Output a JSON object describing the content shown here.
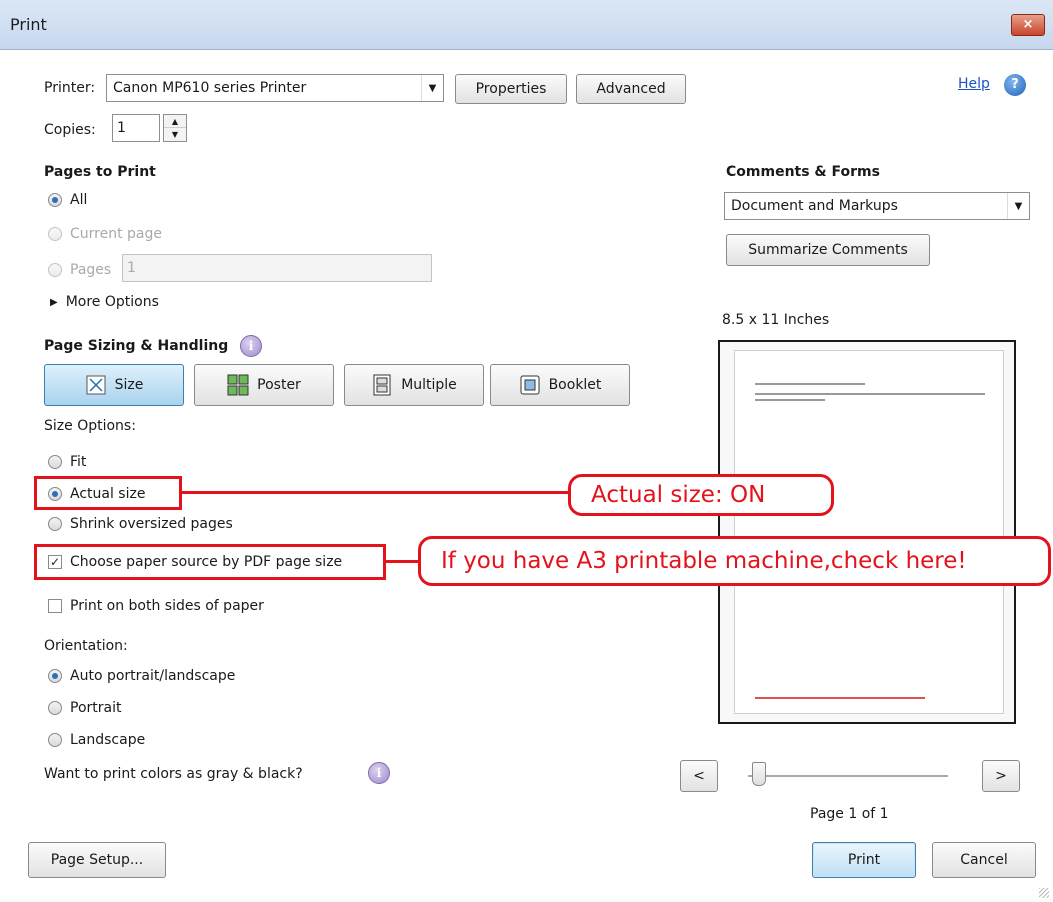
{
  "window": {
    "title": "Print",
    "close_glyph": "×"
  },
  "printer": {
    "label": "Printer:",
    "selected": "Canon MP610 series Printer",
    "properties_label": "Properties",
    "advanced_label": "Advanced",
    "help_label": "Help"
  },
  "copies": {
    "label": "Copies:",
    "value": "1"
  },
  "pages_to_print": {
    "heading": "Pages to Print",
    "all": "All",
    "current_page": "Current page",
    "pages": "Pages",
    "pages_value": "1",
    "more_options": "More Options"
  },
  "page_sizing": {
    "heading": "Page Sizing & Handling",
    "modes": [
      "Size",
      "Poster",
      "Multiple",
      "Booklet"
    ],
    "size_options_label": "Size Options:",
    "fit": "Fit",
    "actual_size": "Actual size",
    "shrink": "Shrink oversized pages",
    "choose_paper": "Choose paper source by PDF page size",
    "both_sides": "Print on both sides of paper",
    "orientation_label": "Orientation:",
    "auto": "Auto portrait/landscape",
    "portrait": "Portrait",
    "landscape": "Landscape",
    "gray_question": "Want to print colors as gray & black?"
  },
  "comments_forms": {
    "heading": "Comments & Forms",
    "selected": "Document and Markups",
    "summarize_label": "Summarize Comments"
  },
  "preview": {
    "size_label": "8.5 x 11 Inches",
    "page_status": "Page 1 of 1",
    "prev_label": "<",
    "next_label": ">"
  },
  "footer": {
    "page_setup": "Page Setup...",
    "print": "Print",
    "cancel": "Cancel"
  },
  "annotations": {
    "actual_size_note": "Actual size: ON",
    "a3_note": "If you have A3 printable machine,check here!"
  },
  "colors": {
    "annotation_red": "#e3121b",
    "help_blue": "#1a55c4"
  }
}
